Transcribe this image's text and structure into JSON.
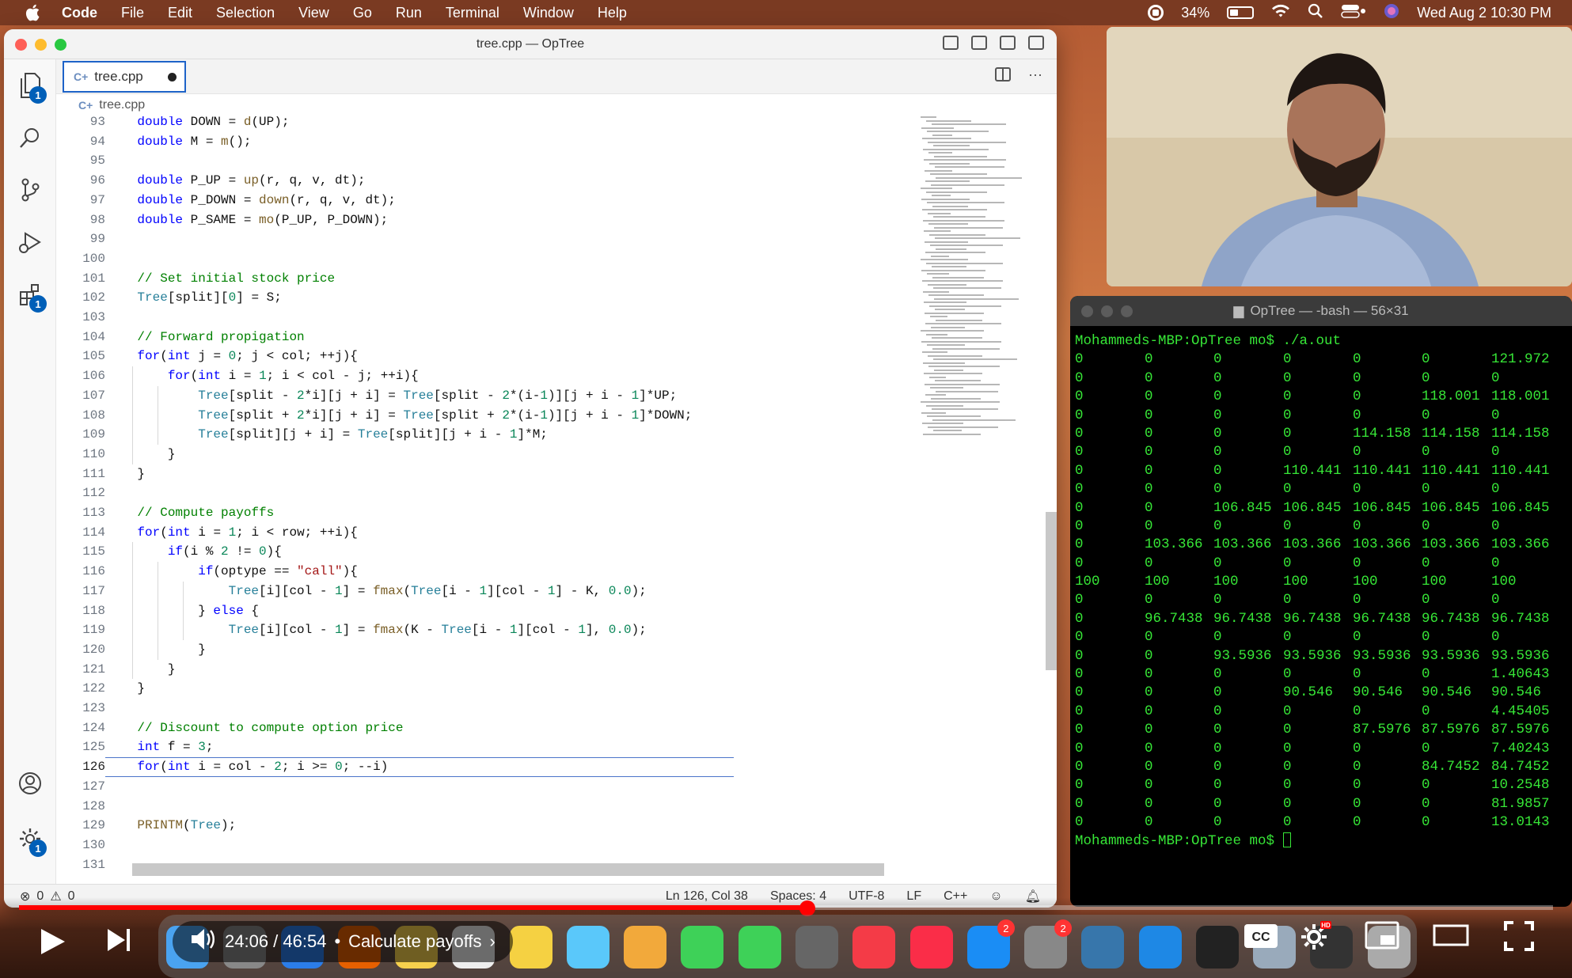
{
  "menubar": {
    "items": [
      "Code",
      "File",
      "Edit",
      "Selection",
      "View",
      "Go",
      "Run",
      "Terminal",
      "Window",
      "Help"
    ],
    "battery": "34%",
    "datetime": "Wed Aug 2  10:30 PM"
  },
  "vscode": {
    "window_title": "tree.cpp — OpTree",
    "tab_label": "tree.cpp",
    "breadcrumb": "tree.cpp",
    "activity_badges": {
      "explorer": "1",
      "extensions": "1",
      "settings": "1"
    },
    "editor": {
      "first_line": 93,
      "current_line": 126,
      "lines": [
        "    double DOWN = d(UP);",
        "    double M = m();",
        "",
        "    double P_UP = up(r, q, v, dt);",
        "    double P_DOWN = down(r, q, v, dt);",
        "    double P_SAME = mo(P_UP, P_DOWN);",
        "",
        "",
        "    // Set initial stock price",
        "    Tree[split][0] = S;",
        "",
        "    // Forward propigation",
        "    for(int j = 0; j < col; ++j){",
        "        for(int i = 1; i < col - j; ++i){",
        "            Tree[split - 2*i][j + i] = Tree[split - 2*(i-1)][j + i - 1]*UP;",
        "            Tree[split + 2*i][j + i] = Tree[split + 2*(i-1)][j + i - 1]*DOWN;",
        "            Tree[split][j + i] = Tree[split][j + i - 1]*M;",
        "        }",
        "    }",
        "",
        "    // Compute payoffs",
        "    for(int i = 1; i < row; ++i){",
        "        if(i % 2 != 0){",
        "            if(optype == \"call\"){",
        "                Tree[i][col - 1] = fmax(Tree[i - 1][col - 1] - K, 0.0);",
        "            } else {",
        "                Tree[i][col - 1] = fmax(K - Tree[i - 1][col - 1], 0.0);",
        "            }",
        "        }",
        "    }",
        "",
        "    // Discount to compute option price",
        "    int f = 3;",
        "    for(int i = col - 2; i >= 0; --i)",
        "",
        "",
        "    PRINTM(Tree);",
        "",
        ""
      ]
    },
    "status": {
      "errors": "0",
      "warnings": "0",
      "position": "Ln 126, Col 38",
      "spaces": "Spaces: 4",
      "encoding": "UTF-8",
      "eol": "LF",
      "language": "C++"
    }
  },
  "terminal": {
    "title": "OpTree — -bash — 56×31",
    "prompt_cmd": "Mohammeds-MBP:OpTree mo$ ./a.out",
    "rows": [
      [
        "0",
        "0",
        "0",
        "0",
        "0",
        "0",
        "121.972"
      ],
      [
        "0",
        "0",
        "0",
        "0",
        "0",
        "0",
        "0"
      ],
      [
        "0",
        "0",
        "0",
        "0",
        "0",
        "118.001",
        "118.001"
      ],
      [
        "0",
        "0",
        "0",
        "0",
        "0",
        "0",
        "0"
      ],
      [
        "0",
        "0",
        "0",
        "0",
        "114.158",
        "114.158",
        "114.158"
      ],
      [
        "0",
        "0",
        "0",
        "0",
        "0",
        "0",
        "0"
      ],
      [
        "0",
        "0",
        "0",
        "110.441",
        "110.441",
        "110.441",
        "110.441"
      ],
      [
        "0",
        "0",
        "0",
        "0",
        "0",
        "0",
        "0"
      ],
      [
        "0",
        "0",
        "106.845",
        "106.845",
        "106.845",
        "106.845",
        "106.845"
      ],
      [
        "0",
        "0",
        "0",
        "0",
        "0",
        "0",
        "0"
      ],
      [
        "0",
        "103.366",
        "103.366",
        "103.366",
        "103.366",
        "103.366",
        "103.366"
      ],
      [
        "0",
        "0",
        "0",
        "0",
        "0",
        "0",
        "0"
      ],
      [
        "100",
        "100",
        "100",
        "100",
        "100",
        "100",
        "100"
      ],
      [
        "0",
        "0",
        "0",
        "0",
        "0",
        "0",
        "0"
      ],
      [
        "0",
        "96.7438",
        "96.7438",
        "96.7438",
        "96.7438",
        "96.7438",
        "96.7438"
      ],
      [
        "0",
        "0",
        "0",
        "0",
        "0",
        "0",
        "0"
      ],
      [
        "0",
        "0",
        "93.5936",
        "93.5936",
        "93.5936",
        "93.5936",
        "93.5936"
      ],
      [
        "0",
        "0",
        "0",
        "0",
        "0",
        "0",
        "1.40643"
      ],
      [
        "0",
        "0",
        "0",
        "90.546",
        "90.546",
        "90.546",
        "90.546"
      ],
      [
        "0",
        "0",
        "0",
        "0",
        "0",
        "0",
        "4.45405"
      ],
      [
        "0",
        "0",
        "0",
        "0",
        "87.5976",
        "87.5976",
        "87.5976"
      ],
      [
        "0",
        "0",
        "0",
        "0",
        "0",
        "0",
        "7.40243"
      ],
      [
        "0",
        "0",
        "0",
        "0",
        "0",
        "84.7452",
        "84.7452"
      ],
      [
        "0",
        "0",
        "0",
        "0",
        "0",
        "0",
        "10.2548"
      ],
      [
        "0",
        "0",
        "0",
        "0",
        "0",
        "0",
        "81.9857"
      ],
      [
        "0",
        "0",
        "0",
        "0",
        "0",
        "0",
        "13.0143"
      ]
    ],
    "final_prompt": "Mohammeds-MBP:OpTree mo$ "
  },
  "youtube": {
    "time": "24:06 / 46:54",
    "chapter": "Calculate payoffs",
    "progress": 0.514,
    "dock_badges": {
      "app_store": "2",
      "system_settings": "2"
    }
  }
}
